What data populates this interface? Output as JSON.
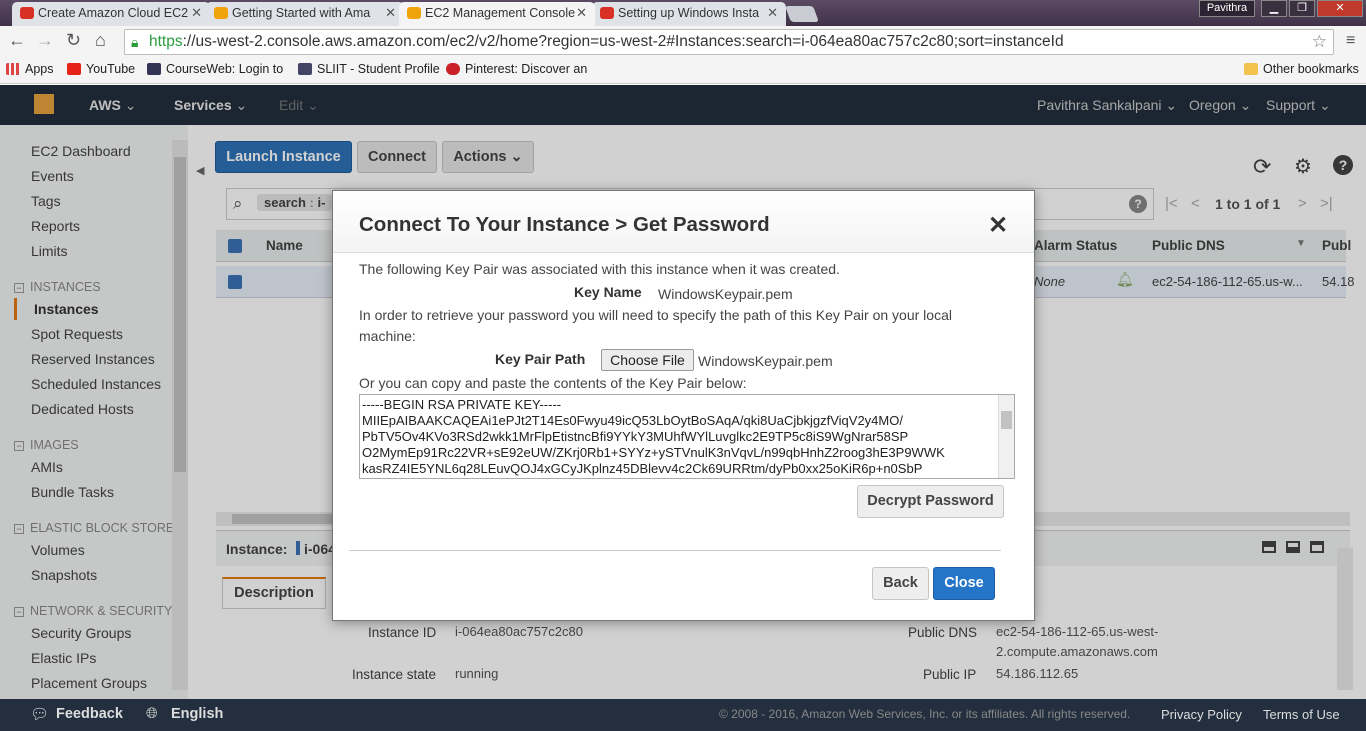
{
  "browser": {
    "tabs": [
      {
        "label": "Create Amazon Cloud EC2",
        "favicon_color": "#d93025"
      },
      {
        "label": "Getting Started with Ama",
        "favicon_color": "#f0a30a"
      },
      {
        "label": "EC2 Management Console",
        "favicon_color": "#f0a30a"
      },
      {
        "label": "Setting up Windows Insta",
        "favicon_color": "#d93025"
      }
    ],
    "window_user": "Pavithra",
    "url_scheme": "https",
    "url_rest": "://us-west-2.console.aws.amazon.com/ec2/v2/home?region=us-west-2#Instances:search=i-064ea80ac757c2c80;sort=instanceId",
    "bookmarks": [
      {
        "label": "Apps",
        "icon": "apps-grid-icon",
        "color": "#d44"
      },
      {
        "label": "YouTube",
        "icon": "youtube-icon",
        "color": "#e62117"
      },
      {
        "label": "CourseWeb: Login to",
        "icon": "courseweb-icon",
        "color": "#335"
      },
      {
        "label": "SLIIT - Student Profile",
        "icon": "sliit-icon",
        "color": "#446"
      },
      {
        "label": "Pinterest: Discover an",
        "icon": "pinterest-icon",
        "color": "#cb2027"
      }
    ],
    "other_bookmarks": "Other bookmarks"
  },
  "aws_nav": {
    "brand": "AWS",
    "services": "Services",
    "edit": "Edit",
    "user": "Pavithra Sankalpani",
    "region": "Oregon",
    "support": "Support"
  },
  "sidebar": {
    "top_items": [
      "EC2 Dashboard",
      "Events",
      "Tags",
      "Reports",
      "Limits"
    ],
    "sections": [
      {
        "header": "INSTANCES",
        "items": [
          "Instances",
          "Spot Requests",
          "Reserved Instances",
          "Scheduled Instances",
          "Dedicated Hosts"
        ]
      },
      {
        "header": "IMAGES",
        "items": [
          "AMIs",
          "Bundle Tasks"
        ]
      },
      {
        "header": "ELASTIC BLOCK STORE",
        "items": [
          "Volumes",
          "Snapshots"
        ]
      },
      {
        "header": "NETWORK & SECURITY",
        "items": [
          "Security Groups",
          "Elastic IPs",
          "Placement Groups"
        ]
      }
    ],
    "selected": "Instances"
  },
  "main": {
    "launch_button": "Launch Instance",
    "connect_button": "Connect",
    "actions_button": "Actions",
    "search_token": "search",
    "search_token_rest": "i-",
    "pagination": "1 to 1 of 1",
    "columns": [
      "Name",
      "Alarm Status",
      "Public DNS",
      "Publ"
    ],
    "row": {
      "alarm": "None",
      "public_dns": "ec2-54-186-112-65.us-w...",
      "public_ip_trunc": "54.18"
    },
    "instance_label": "Instance:",
    "instance_trunc": "i-064",
    "description_tab": "Description",
    "details": {
      "instance_id_label": "Instance ID",
      "instance_id": "i-064ea80ac757c2c80",
      "instance_state_label": "Instance state",
      "instance_state": "running",
      "public_dns_label": "Public DNS",
      "public_dns_1": "ec2-54-186-112-65.us-west-",
      "public_dns_2": "2.compute.amazonaws.com",
      "public_ip_label": "Public IP",
      "public_ip": "54.186.112.65"
    }
  },
  "modal": {
    "title": "Connect To Your Instance > Get Password",
    "intro": "The following Key Pair was associated with this instance when it was created.",
    "key_name_label": "Key Name",
    "key_name": "WindowsKeypair.pem",
    "instructions_1": "In order to retrieve your password you will need to specify the path of this Key Pair on your local",
    "instructions_2": "machine:",
    "key_pair_path_label": "Key Pair Path",
    "choose_file": "Choose File",
    "chosen_file": "WindowsKeypair.pem",
    "paste_text": "Or you can copy and paste the contents of the Key Pair below:",
    "key_contents": "-----BEGIN RSA PRIVATE KEY-----\nMIIEpAIBAAKCAQEAi1ePJt2T14Es0Fwyu49icQ53LbOytBoSAqA/qki8UaCjbkjgzfViqV2y4MO/\nPbTV5Ov4KVo3RSd2wkk1MrFlpEtistncBfi9YYkY3MUhfWYlLuvglkc2E9TP5c8iS9WgNrar58SP\nO2MymEp91Rc22VR+sE92eUW/ZKrj0Rb1+SYYz+ySTVnulK3nVqvL/n99qbHnhZ2roog3hE3P9WWK\nkasRZ4IE5YNL6q28LEuvQOJ4xGCyJKplnz45DBlevv4c2Ck69URRtm/dyPb0xx25oKiR6p+n0SbP",
    "decrypt_button": "Decrypt Password",
    "back_button": "Back",
    "close_button": "Close"
  },
  "footer": {
    "feedback": "Feedback",
    "language": "English",
    "copyright": "© 2008 - 2016, Amazon Web Services, Inc. or its affiliates. All rights reserved.",
    "privacy": "Privacy Policy",
    "terms": "Terms of Use"
  }
}
